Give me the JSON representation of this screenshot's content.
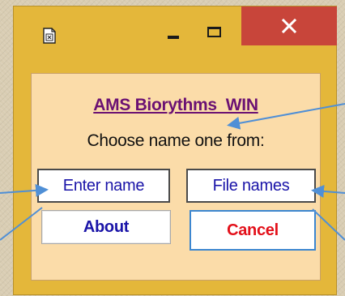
{
  "window": {
    "icon": "app-document-icon",
    "controls": {
      "minimize_icon": "minimize-icon",
      "maximize_icon": "maximize-icon",
      "close_icon": "close-icon"
    }
  },
  "dialog": {
    "title": "AMS Biorythms  WIN",
    "prompt": "Choose name one from:",
    "buttons": {
      "enter_name": "Enter name",
      "file_names": "File names",
      "about": "About",
      "cancel": "Cancel"
    }
  },
  "colors": {
    "frame": "#e4b73a",
    "client_bg": "#fbdca9",
    "close_button": "#c8453a",
    "title_link": "#6b1173",
    "button_text": "#1a14a8",
    "cancel_text": "#e3101a",
    "callout_arrow": "#4f8fd6"
  }
}
